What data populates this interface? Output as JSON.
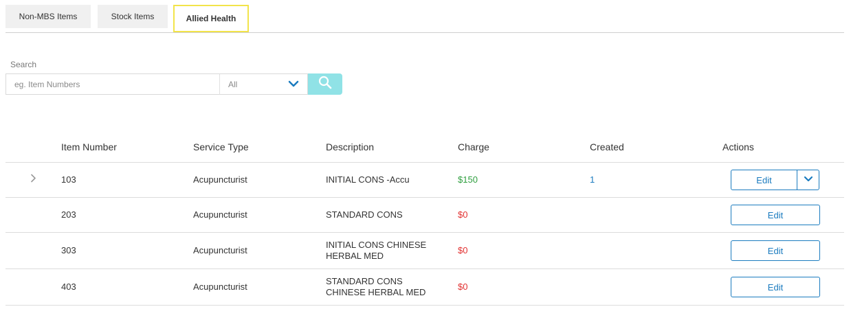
{
  "tabs": [
    {
      "label": "Non-MBS Items"
    },
    {
      "label": "Stock Items"
    },
    {
      "label": "Allied Health"
    }
  ],
  "search": {
    "label": "Search",
    "placeholder": "eg. Item Numbers",
    "filter_value": "All"
  },
  "table": {
    "headers": {
      "item_number": "Item Number",
      "service_type": "Service Type",
      "description": "Description",
      "charge": "Charge",
      "created": "Created",
      "actions": "Actions"
    },
    "rows": [
      {
        "item_number": "103",
        "service_type": "Acupuncturist",
        "description": "INITIAL CONS -Accu",
        "charge": "$150",
        "created": "1",
        "action": "Edit"
      },
      {
        "item_number": "203",
        "service_type": "Acupuncturist",
        "description": "STANDARD CONS",
        "charge": "$0",
        "created": "",
        "action": "Edit"
      },
      {
        "item_number": "303",
        "service_type": "Acupuncturist",
        "description": "INITIAL CONS CHINESE HERBAL MED",
        "charge": "$0",
        "created": "",
        "action": "Edit"
      },
      {
        "item_number": "403",
        "service_type": "Acupuncturist",
        "description": "STANDARD CONS CHINESE HERBAL MED",
        "charge": "$0",
        "created": "",
        "action": "Edit"
      }
    ]
  },
  "colors": {
    "accent": "#1a7bbf",
    "active_tab_border": "#f2e44a",
    "search_button": "#90e2e6",
    "charge_positive": "#2e9e3e",
    "charge_zero": "#e23030"
  },
  "icons": {
    "search": "search-icon",
    "select": "chevron-down-icon",
    "expand": "chevron-right-icon",
    "edit_menu": "chevron-down-icon"
  }
}
